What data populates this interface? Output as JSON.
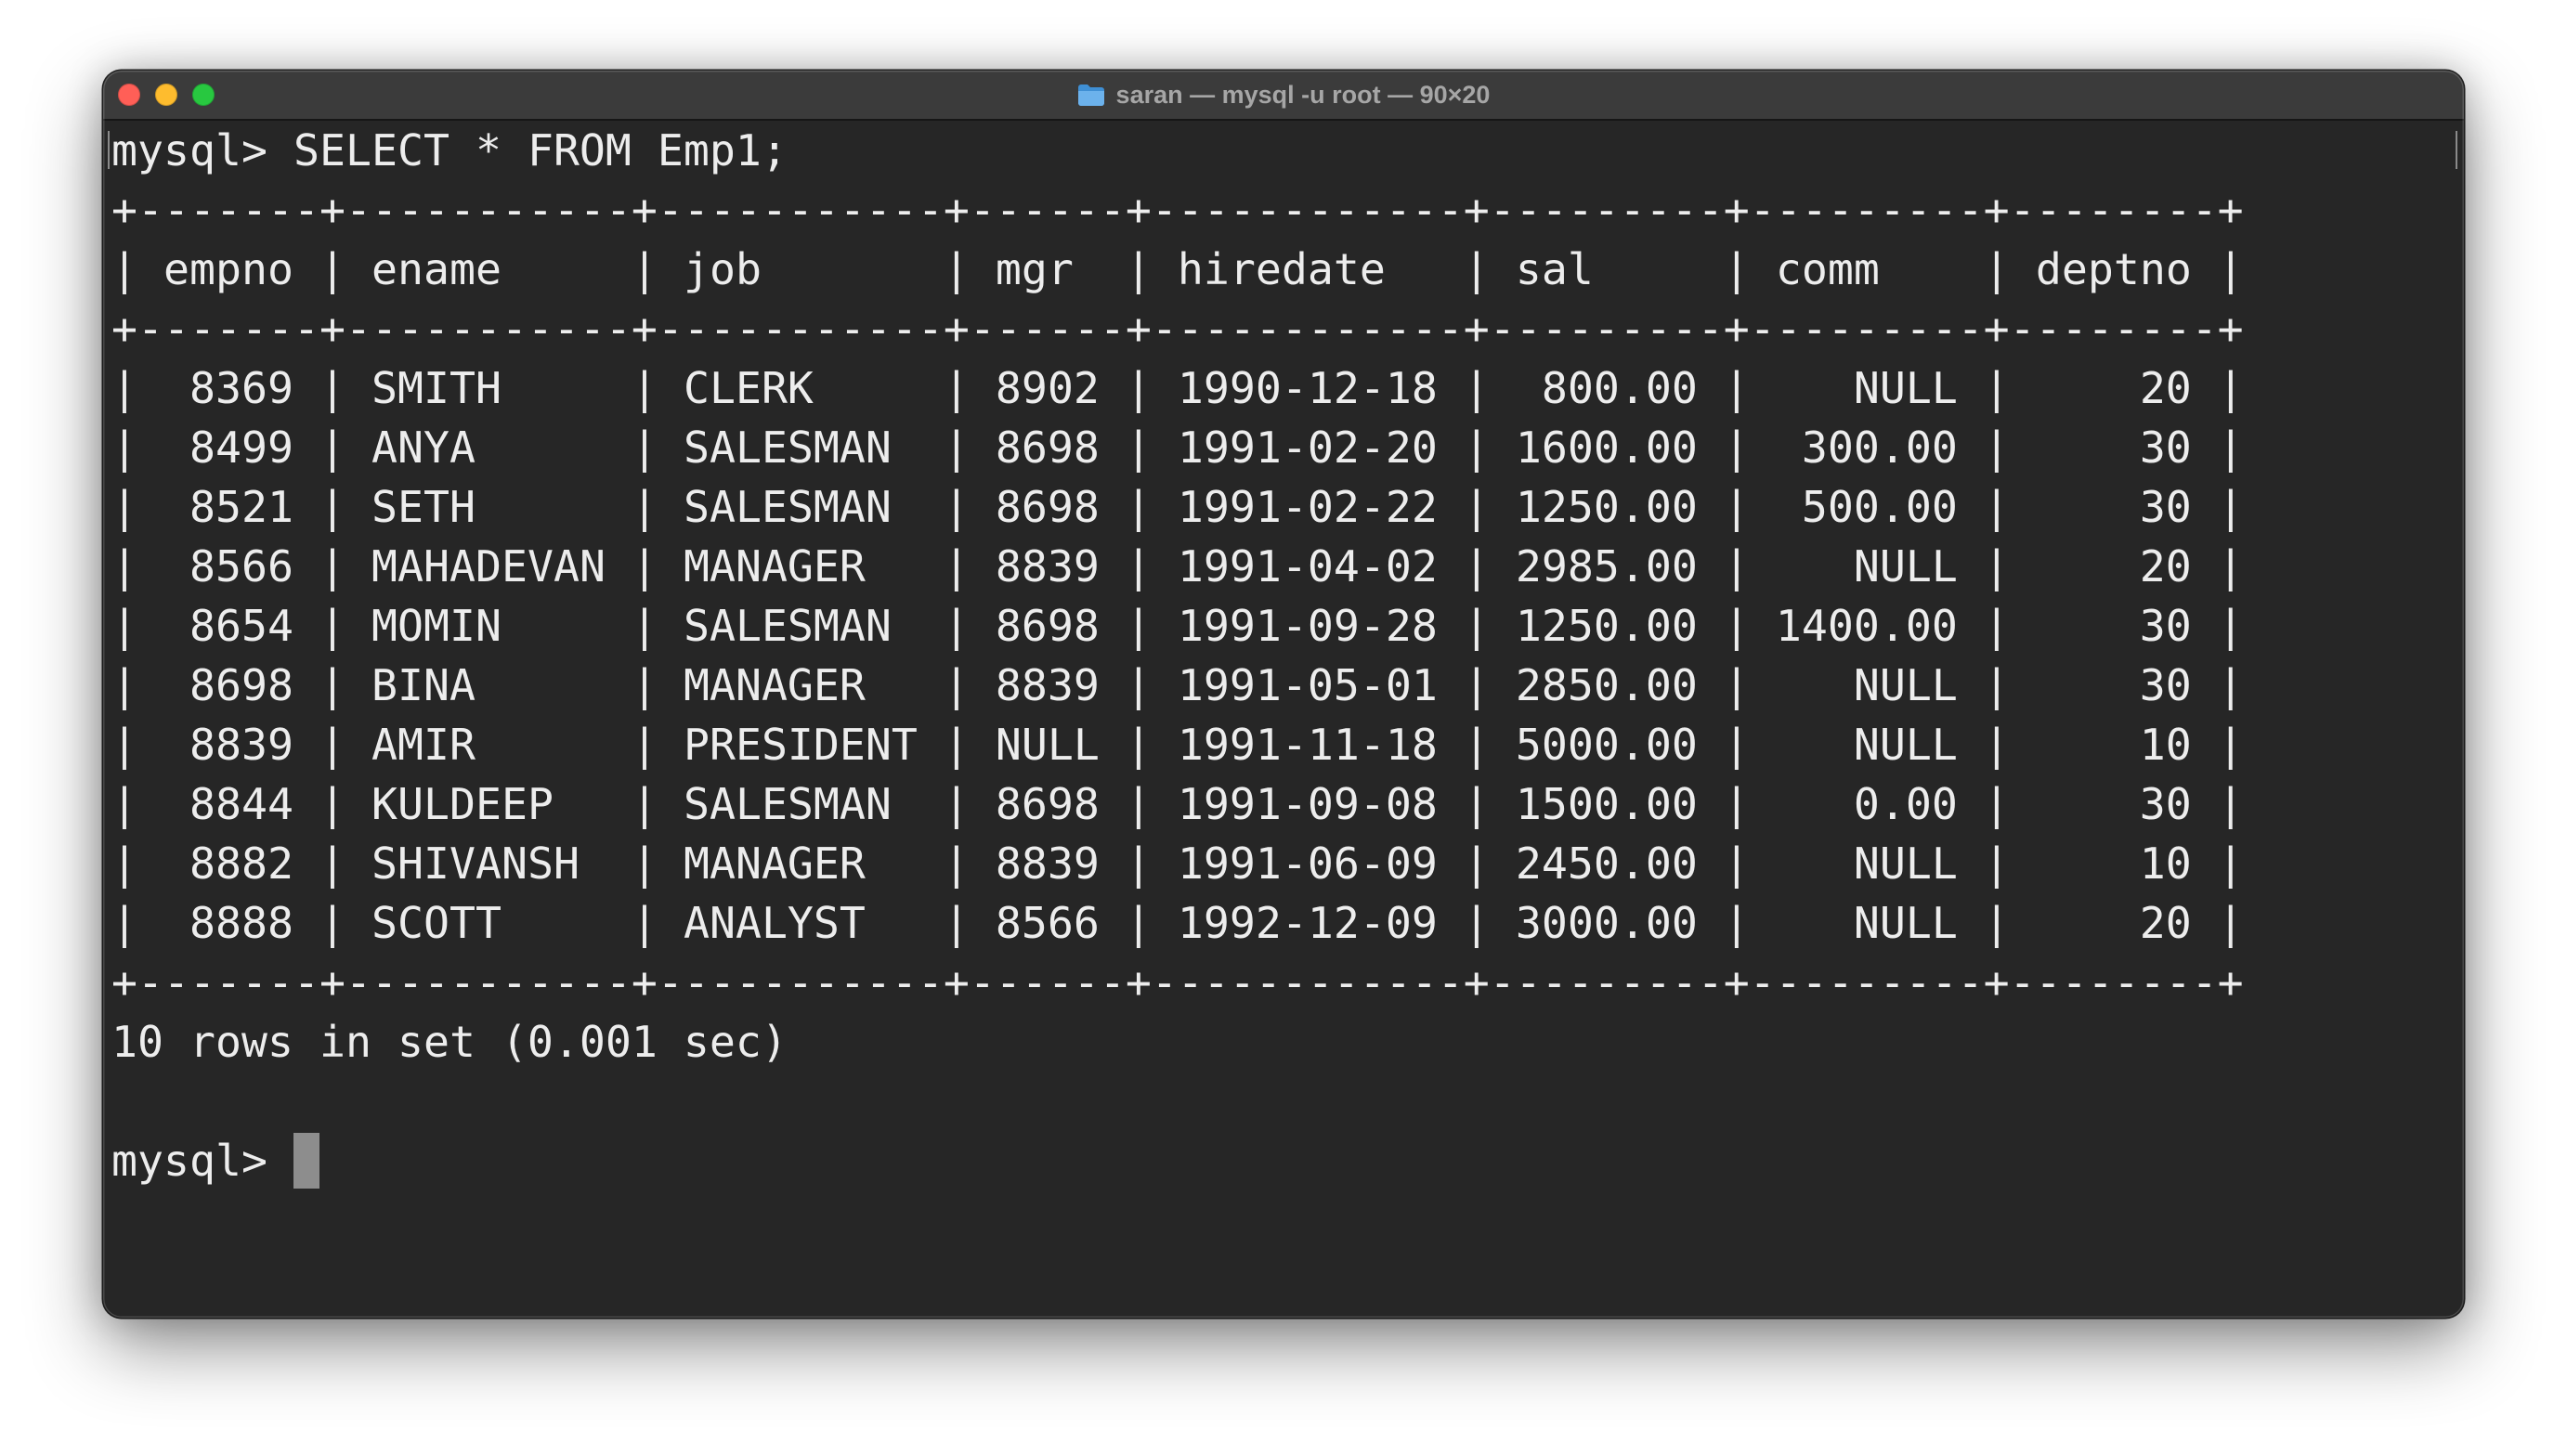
{
  "window": {
    "title": "saran — mysql -u root — 90×20",
    "title_icon": "folder-icon",
    "controls": [
      {
        "icon": "close-icon",
        "color": "#ff5f57"
      },
      {
        "icon": "minimize-icon",
        "color": "#febc2e"
      },
      {
        "icon": "zoom-icon",
        "color": "#28c840"
      }
    ]
  },
  "colors": {
    "page_background": "#ffffff",
    "titlebar": "#3b3b3b",
    "terminal_background": "#262626",
    "terminal_text": "#ededed",
    "title_text": "#a6a6a6",
    "cursor": "#8d8d8d",
    "folder": "#6cb2ec"
  },
  "terminal": {
    "prompt": "mysql>",
    "command": "SELECT * FROM Emp1;",
    "table": {
      "border": "+-------+-----------+-----------+------+------------+---------+---------+--------+",
      "separator": "|",
      "columns": [
        {
          "name": "empno",
          "align": "right"
        },
        {
          "name": "ename",
          "align": "left"
        },
        {
          "name": "job",
          "align": "left"
        },
        {
          "name": "mgr",
          "align": "right"
        },
        {
          "name": "hiredate",
          "align": "left"
        },
        {
          "name": "sal",
          "align": "right"
        },
        {
          "name": "comm",
          "align": "right"
        },
        {
          "name": "deptno",
          "align": "right"
        }
      ],
      "rows": [
        [
          "8369",
          "SMITH",
          "CLERK",
          "8902",
          "1990-12-18",
          "800.00",
          "NULL",
          "20"
        ],
        [
          "8499",
          "ANYA",
          "SALESMAN",
          "8698",
          "1991-02-20",
          "1600.00",
          "300.00",
          "30"
        ],
        [
          "8521",
          "SETH",
          "SALESMAN",
          "8698",
          "1991-02-22",
          "1250.00",
          "500.00",
          "30"
        ],
        [
          "8566",
          "MAHADEVAN",
          "MANAGER",
          "8839",
          "1991-04-02",
          "2985.00",
          "NULL",
          "20"
        ],
        [
          "8654",
          "MOMIN",
          "SALESMAN",
          "8698",
          "1991-09-28",
          "1250.00",
          "1400.00",
          "30"
        ],
        [
          "8698",
          "BINA",
          "MANAGER",
          "8839",
          "1991-05-01",
          "2850.00",
          "NULL",
          "30"
        ],
        [
          "8839",
          "AMIR",
          "PRESIDENT",
          "NULL",
          "1991-11-18",
          "5000.00",
          "NULL",
          "10"
        ],
        [
          "8844",
          "KULDEEP",
          "SALESMAN",
          "8698",
          "1991-09-08",
          "1500.00",
          "0.00",
          "30"
        ],
        [
          "8882",
          "SHIVANSH",
          "MANAGER",
          "8839",
          "1991-06-09",
          "2450.00",
          "NULL",
          "10"
        ],
        [
          "8888",
          "SCOTT",
          "ANALYST",
          "8566",
          "1992-12-09",
          "3000.00",
          "NULL",
          "20"
        ]
      ]
    },
    "status": "10 rows in set (0.001 sec)",
    "next_prompt": "mysql>"
  }
}
